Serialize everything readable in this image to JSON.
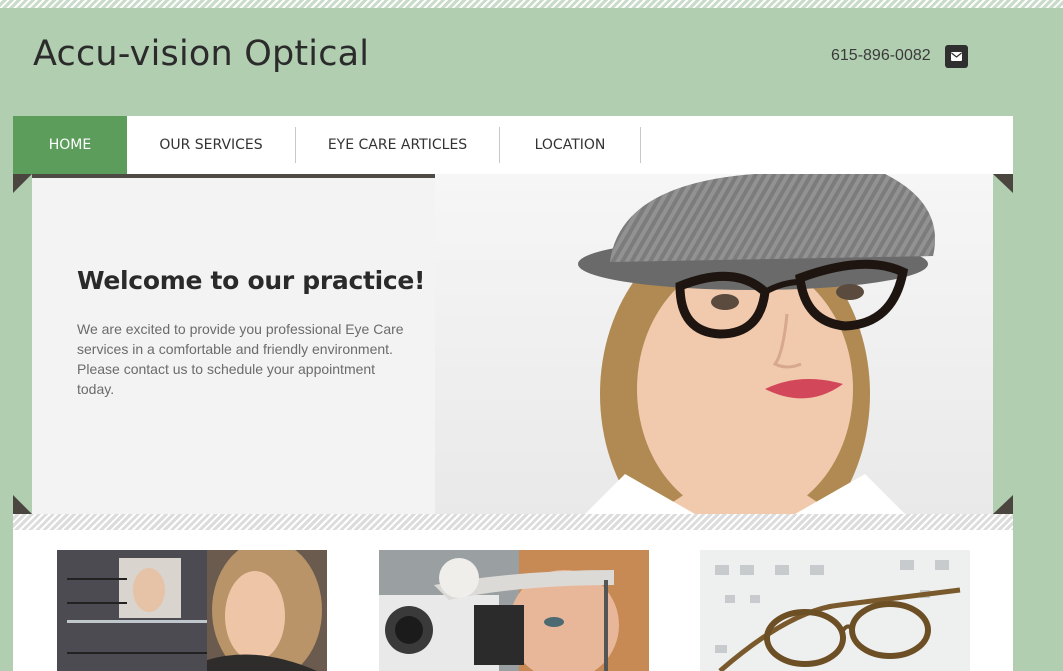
{
  "header": {
    "site_title": "Accu-vision Optical",
    "phone": "615-896-0082"
  },
  "nav": {
    "items": [
      {
        "label": "HOME",
        "active": true
      },
      {
        "label": "OUR SERVICES",
        "active": false
      },
      {
        "label": "EYE CARE ARTICLES",
        "active": false
      },
      {
        "label": "LOCATION",
        "active": false
      }
    ]
  },
  "hero": {
    "heading": "Welcome to our practice!",
    "body": "We are excited to provide you professional Eye Care services in a comfortable and friendly environment.  Please contact us to schedule your appointment today."
  },
  "colors": {
    "background": "#b1ceb1",
    "nav_active": "#5c9d5c",
    "text_dark": "#2a2a2a"
  },
  "icons": {
    "mail": "envelope-icon"
  }
}
